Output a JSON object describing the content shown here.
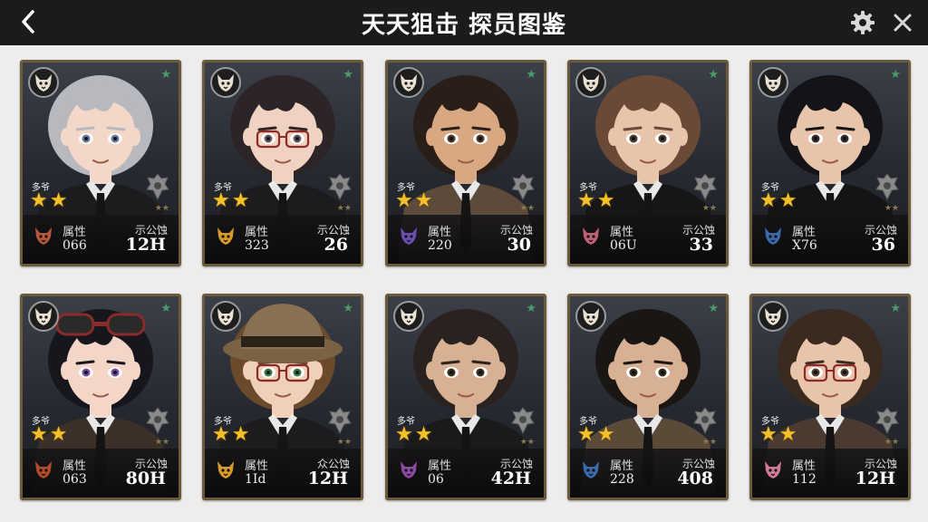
{
  "header": {
    "title": "天天狙击 探员图鉴"
  },
  "icons": {
    "back": "chevron-left-icon",
    "settings": "gear-icon",
    "close": "close-icon"
  },
  "colors": {
    "topbar": "#1b1b1b",
    "background": "#ededed",
    "card_border": "#6b5a3a",
    "star_on": "#f3c02c",
    "corner_star": "#4c9a6a"
  },
  "cards": [
    {
      "hair": "#b7b9bf",
      "skin": "#f3d7c8",
      "eyes": "#6a7a9a",
      "glasses": false,
      "hat": false,
      "goggles": false,
      "coat": "#1c1c1e",
      "stars": 2,
      "rank_label": "多爷",
      "attr_label": "属性",
      "attr_value": "066",
      "stat_label": "示公蚀",
      "stat_value": "12H",
      "animal": "fox-icon",
      "animal_color": "#b5553a"
    },
    {
      "hair": "#2c2426",
      "skin": "#f0d2c2",
      "eyes": "#6a5a5a",
      "glasses": true,
      "hat": false,
      "goggles": false,
      "coat": "#1c1c1e",
      "stars": 2,
      "rank_label": "多爷",
      "attr_label": "属性",
      "attr_value": "323",
      "stat_label": "示公蚀",
      "stat_value": "26",
      "animal": "fox-icon",
      "animal_color": "#d89a2a"
    },
    {
      "hair": "#2a1e18",
      "skin": "#d8a882",
      "eyes": "#4a3422",
      "glasses": false,
      "hat": false,
      "goggles": false,
      "coat": "#5c4a3a",
      "stars": 2,
      "rank_label": "多爷",
      "attr_label": "属性",
      "attr_value": "220",
      "stat_label": "示公蚀",
      "stat_value": "30",
      "animal": "wolf-icon",
      "animal_color": "#6a4fb0"
    },
    {
      "hair": "#6a4a36",
      "skin": "#e8c4aa",
      "eyes": "#4a3a2a",
      "glasses": false,
      "hat": false,
      "goggles": false,
      "coat": "#161616",
      "stars": 2,
      "rank_label": "多爷",
      "attr_label": "属性",
      "attr_value": "06U",
      "stat_label": "示公蚀",
      "stat_value": "33",
      "animal": "cat-icon",
      "animal_color": "#c2607a"
    },
    {
      "hair": "#141418",
      "skin": "#e8c4aa",
      "eyes": "#3a2a2a",
      "glasses": false,
      "hat": false,
      "goggles": false,
      "coat": "#141414",
      "stars": 2,
      "rank_label": "多爷",
      "attr_label": "属性",
      "attr_value": "X76",
      "stat_label": "示公蚀",
      "stat_value": "36",
      "animal": "wolf-icon",
      "animal_color": "#3a6aa8"
    },
    {
      "hair": "#16161c",
      "skin": "#f4d6c8",
      "eyes": "#7a4aa0",
      "glasses": false,
      "hat": false,
      "goggles": true,
      "coat": "#3a3028",
      "stars": 2,
      "rank_label": "多爷",
      "attr_label": "属性",
      "attr_value": "063",
      "stat_label": "示公蚀",
      "stat_value": "80H",
      "animal": "fox-icon",
      "animal_color": "#b04a2a"
    },
    {
      "hair": "#6a4a2a",
      "skin": "#f0d0b8",
      "eyes": "#3a7a4a",
      "glasses": true,
      "hat": true,
      "goggles": false,
      "coat": "#1c1c1e",
      "stars": 2,
      "rank_label": "多爷",
      "attr_label": "属性",
      "attr_value": "1Id",
      "stat_label": "众公蚀",
      "stat_value": "12H",
      "animal": "fox-icon",
      "animal_color": "#d89a2a"
    },
    {
      "hair": "#2a221e",
      "skin": "#d8b094",
      "eyes": "#3a2a1a",
      "glasses": false,
      "hat": false,
      "goggles": false,
      "coat": "#1a1a1a",
      "stars": 2,
      "rank_label": "多爷",
      "attr_label": "属性",
      "attr_value": "06",
      "stat_label": "示公蚀",
      "stat_value": "42H",
      "animal": "cat-icon",
      "animal_color": "#8a4aa0"
    },
    {
      "hair": "#1a1614",
      "skin": "#d8b094",
      "eyes": "#3a2a1a",
      "glasses": false,
      "hat": false,
      "goggles": false,
      "coat": "#5a4a38",
      "stars": 2,
      "rank_label": "多爷",
      "attr_label": "属性",
      "attr_value": "228",
      "stat_label": "示公蚀",
      "stat_value": "408",
      "animal": "wolf-icon",
      "animal_color": "#3a6aa8"
    },
    {
      "hair": "#3a2a20",
      "skin": "#e8c4aa",
      "eyes": "#4a3a2a",
      "glasses": true,
      "hat": false,
      "goggles": false,
      "coat": "#4a3a30",
      "stars": 2,
      "rank_label": "多爷",
      "attr_label": "属性",
      "attr_value": "112",
      "stat_label": "示公蚀",
      "stat_value": "12H",
      "animal": "pig-icon",
      "animal_color": "#d07a9a"
    }
  ]
}
